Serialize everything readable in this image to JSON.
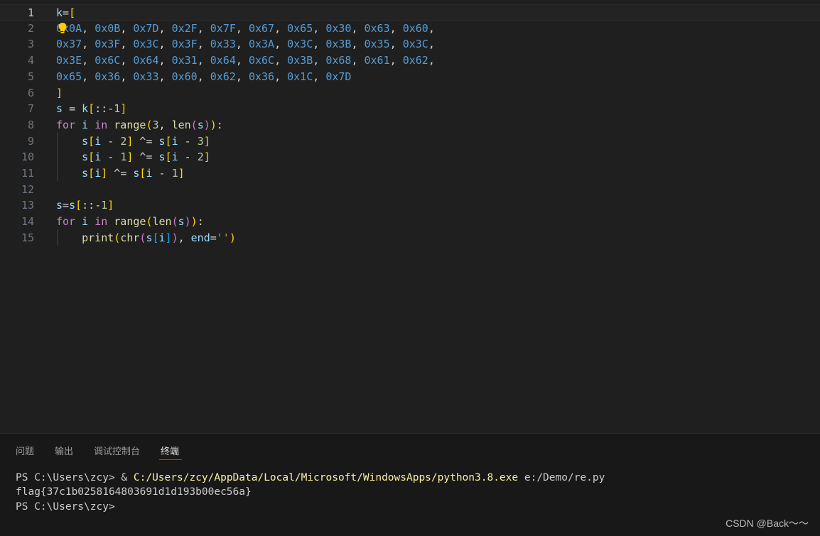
{
  "editor": {
    "lines": [
      {
        "num": "1",
        "text": "k=["
      },
      {
        "num": "2",
        "text": "0x0A, 0x0B, 0x7D, 0x2F, 0x7F, 0x67, 0x65, 0x30, 0x63, 0x60,"
      },
      {
        "num": "3",
        "text": "0x37, 0x3F, 0x3C, 0x3F, 0x33, 0x3A, 0x3C, 0x3B, 0x35, 0x3C,"
      },
      {
        "num": "4",
        "text": "0x3E, 0x6C, 0x64, 0x31, 0x64, 0x6C, 0x3B, 0x68, 0x61, 0x62,"
      },
      {
        "num": "5",
        "text": "0x65, 0x36, 0x33, 0x60, 0x62, 0x36, 0x1C, 0x7D"
      },
      {
        "num": "6",
        "text": "]"
      },
      {
        "num": "7",
        "text": "s = k[::-1]"
      },
      {
        "num": "8",
        "text": "for i in range(3, len(s)):"
      },
      {
        "num": "9",
        "text": "    s[i - 2] ^= s[i - 3]"
      },
      {
        "num": "10",
        "text": "    s[i - 1] ^= s[i - 2]"
      },
      {
        "num": "11",
        "text": "    s[i] ^= s[i - 1]"
      },
      {
        "num": "12",
        "text": ""
      },
      {
        "num": "13",
        "text": "s=s[::-1]"
      },
      {
        "num": "14",
        "text": "for i in range(len(s)):"
      },
      {
        "num": "15",
        "text": "    print(chr(s[i]), end='')"
      }
    ],
    "active_line": 1,
    "colors": {
      "variable": "#9cdcfe",
      "number": "#b5cea8",
      "hex": "#569cd6",
      "keyword": "#c586c0",
      "function": "#dcdcaa",
      "string": "#ce9178",
      "bracket1": "#ffd700",
      "bracket2": "#da70d6",
      "bracket3": "#179fff"
    },
    "lightbulb_icon": "lightbulb-icon"
  },
  "panel": {
    "tabs": [
      {
        "label": "问题",
        "active": false
      },
      {
        "label": "输出",
        "active": false
      },
      {
        "label": "调试控制台",
        "active": false
      },
      {
        "label": "终端",
        "active": true
      }
    ],
    "terminal": {
      "line1_prompt": "PS C:\\Users\\zcy> & ",
      "line1_cmd": "C:/Users/zcy/AppData/Local/Microsoft/WindowsApps/python3.8.exe",
      "line1_arg": " e:/Demo/re.py",
      "line2": "flag{37c1b0258164803691d1d193b00ec56a}",
      "line3": "PS C:\\Users\\zcy>"
    },
    "accent": "#0078d4"
  },
  "watermark": "CSDN @Back～～"
}
